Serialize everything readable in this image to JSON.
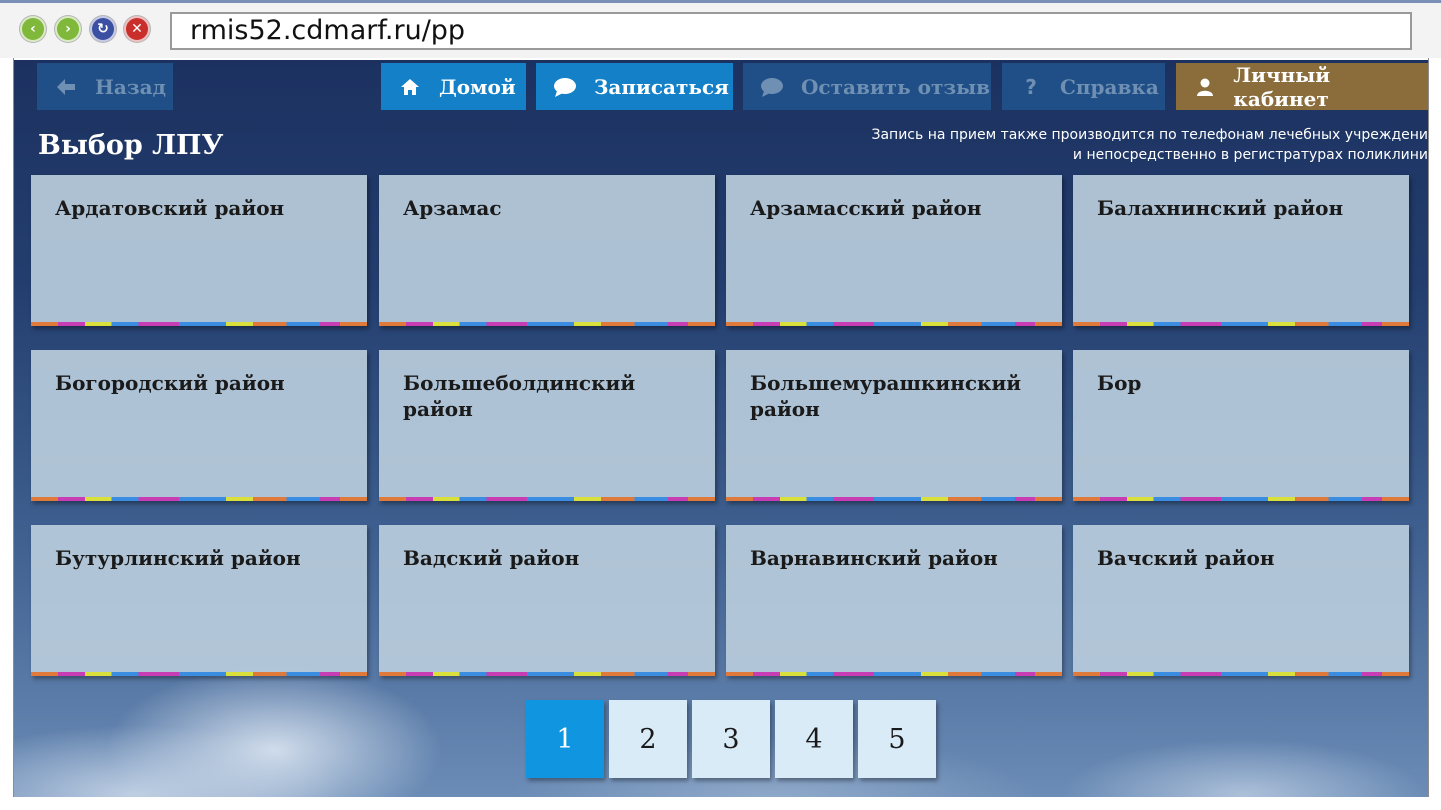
{
  "browser": {
    "url": "rmis52.cdmarf.ru/pp"
  },
  "nav": {
    "back": "Назад",
    "home": "Домой",
    "book": "Записаться",
    "review": "Оставить отзыв",
    "help": "Справка",
    "cabinet": "Личный кабинет"
  },
  "page": {
    "title": "Выбор ЛПУ",
    "notice_line1": "Запись на прием также производится по телефонам лечебных учреждени",
    "notice_line2": "и непосредственно в регистратурах поликлини"
  },
  "districts": [
    "Ардатовский район",
    "Арзамас",
    "Арзамасский район",
    "Балахнинский район",
    "Богородский район",
    "Большеболдинский район",
    "Большемурашкинский район",
    "Бор",
    "Бутурлинский район",
    "Вадский район",
    "Варнавинский район",
    "Вачский район"
  ],
  "pagination": {
    "pages": [
      "1",
      "2",
      "3",
      "4",
      "5"
    ],
    "current": "1"
  },
  "colors": {
    "active_button": "#1480c8",
    "disabled_button": "#1f4f86",
    "cabinet_button": "#8a6d3b",
    "active_page": "#1096e0"
  }
}
